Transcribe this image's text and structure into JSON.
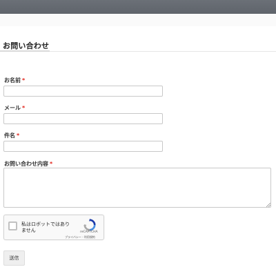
{
  "page": {
    "title": "お問い合わせ"
  },
  "form": {
    "required_mark": "*",
    "fields": [
      {
        "label": "お名前",
        "value": "",
        "placeholder": ""
      },
      {
        "label": "メール",
        "value": "",
        "placeholder": ""
      },
      {
        "label": "件名",
        "value": "",
        "placeholder": ""
      },
      {
        "label": "お問い合わせ内容",
        "value": "",
        "placeholder": ""
      }
    ],
    "submit_label": "送信"
  },
  "recaptcha": {
    "checkbox_label": "私はロボットではありません",
    "brand": "reCAPTCHA",
    "terms": "プライバシー - 利用規約",
    "checked": false
  },
  "colors": {
    "topbar": "#64696f",
    "required": "#e2231a",
    "input_border": "#c8c8c8"
  },
  "icons": {
    "recaptcha_logo": "recaptcha-logo-icon",
    "resize_grip": "resize-grip-icon"
  }
}
